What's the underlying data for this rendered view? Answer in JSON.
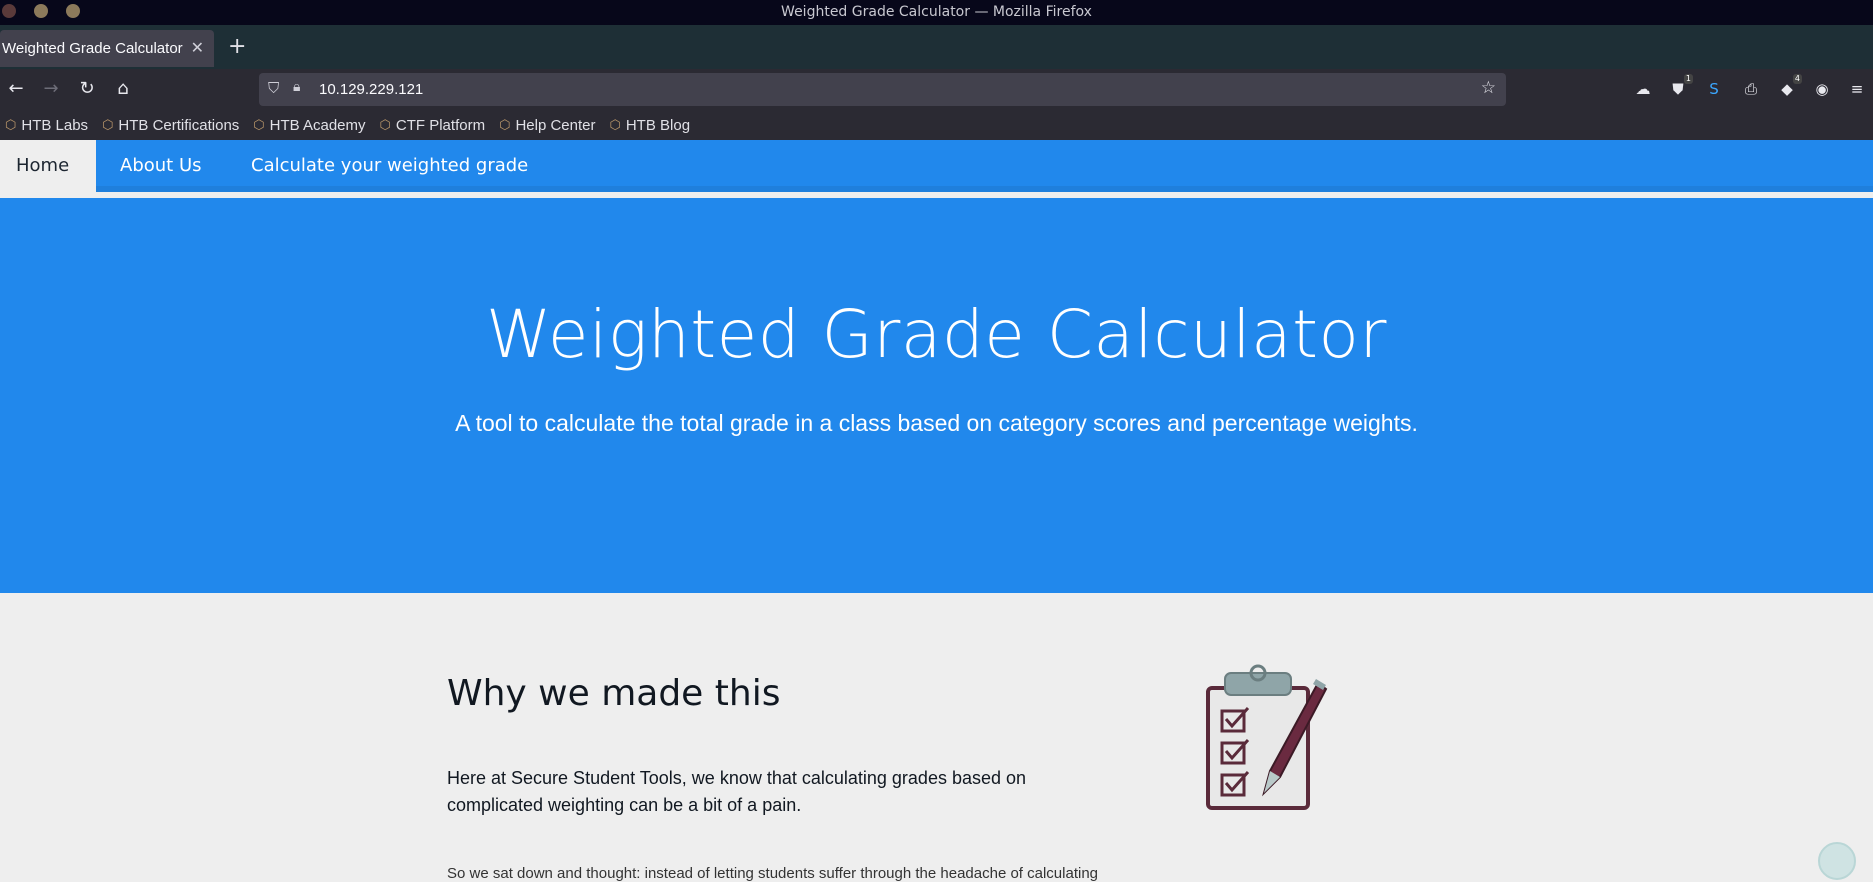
{
  "window": {
    "title": "Weighted Grade Calculator — Mozilla Firefox"
  },
  "tabs": [
    {
      "label": "Weighted Grade Calculator"
    }
  ],
  "newtab": {
    "label": "+"
  },
  "urlbar": {
    "url": "10.129.229.121"
  },
  "extensions": [
    {
      "icon": "cloud-icon"
    },
    {
      "icon": "ublock-icon",
      "badge": "1"
    },
    {
      "icon": "s-icon"
    },
    {
      "icon": "printer-icon"
    },
    {
      "icon": "foxyproxy-icon",
      "badge": "4"
    },
    {
      "icon": "cookie-icon"
    }
  ],
  "bookmarks": [
    {
      "label": "HTB Labs"
    },
    {
      "label": "HTB Certifications"
    },
    {
      "label": "HTB Academy"
    },
    {
      "label": "CTF Platform"
    },
    {
      "label": "Help Center"
    },
    {
      "label": "HTB Blog"
    }
  ],
  "site_nav": {
    "items": [
      {
        "label": "Home"
      },
      {
        "label": "About Us"
      },
      {
        "label": "Calculate your weighted grade"
      }
    ]
  },
  "hero": {
    "title": "Weighted Grade Calculator",
    "subtitle": "A tool to calculate the total grade in a class based on category scores and percentage weights."
  },
  "section": {
    "heading": "Why we made this",
    "paragraph": "Here at Secure Student Tools, we know that calculating grades based on complicated weighting can be a bit of a pain.",
    "paragraph2": "So we sat down and thought: instead of letting students suffer through the headache of calculating"
  },
  "colors": {
    "brand": "#2188ec",
    "background": "#eeeeee"
  }
}
